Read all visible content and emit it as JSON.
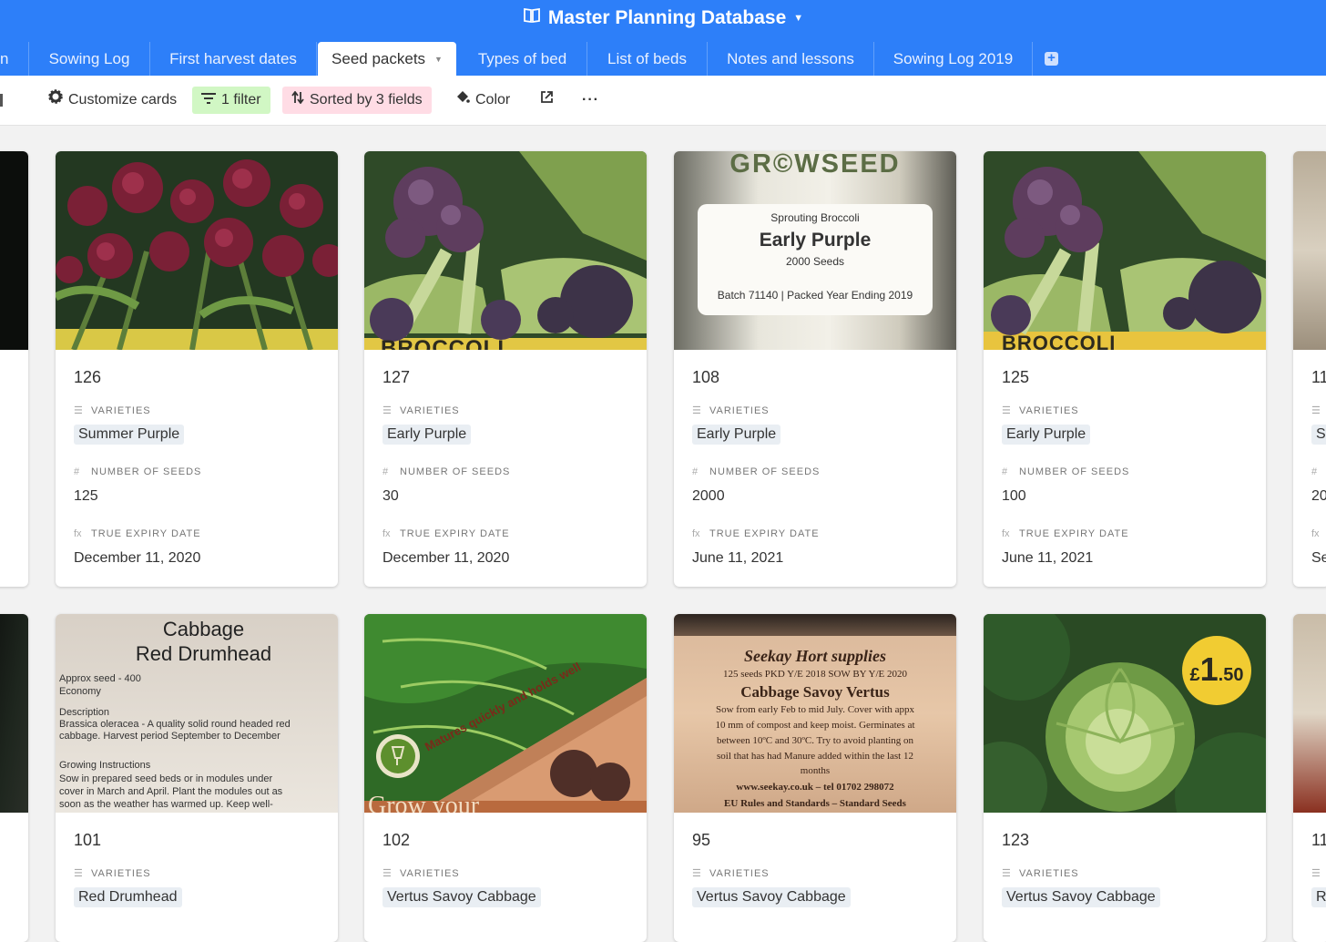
{
  "app": {
    "title": "Master Planning Database"
  },
  "tabs": [
    {
      "label": "n"
    },
    {
      "label": "Sowing Log"
    },
    {
      "label": "First harvest dates"
    },
    {
      "label": "Seed packets"
    },
    {
      "label": "Types of bed"
    },
    {
      "label": "List of beds"
    },
    {
      "label": "Notes and lessons"
    },
    {
      "label": "Sowing Log 2019"
    }
  ],
  "toolbar": {
    "customize": "Customize cards",
    "filter": "1 filter",
    "sort": "Sorted by 3 fields",
    "color": "Color"
  },
  "fields": {
    "varieties": "VARIETIES",
    "seeds": "NUMBER OF SEEDS",
    "expiry": "TRUE EXPIRY DATE"
  },
  "cards_row1": [
    {
      "id": "126",
      "variety": "Summer Purple",
      "seeds": "125",
      "expiry": "December 11, 2020"
    },
    {
      "id": "127",
      "variety": "Early Purple",
      "seeds": "30",
      "expiry": "December 11, 2020"
    },
    {
      "id": "108",
      "variety": "Early Purple",
      "seeds": "2000",
      "expiry": "June 11, 2021"
    },
    {
      "id": "125",
      "variety": "Early Purple",
      "seeds": "100",
      "expiry": "June 11, 2021"
    }
  ],
  "cards_row2": [
    {
      "id": "101",
      "variety": "Red Drumhead"
    },
    {
      "id": "102",
      "variety": "Vertus Savoy Cabbage"
    },
    {
      "id": "95",
      "variety": "Vertus Savoy Cabbage"
    },
    {
      "id": "123",
      "variety": "Vertus Savoy Cabbage"
    }
  ],
  "partial": {
    "r1_id": "11",
    "r1_chip": "Sa",
    "r1_seeds": "20",
    "r1_expiry": "Se",
    "r2_id": "11",
    "r2_chip": "Re"
  },
  "packets": {
    "growseed_brand": "GR©WSEED",
    "growseed_type": "Sprouting Broccoli",
    "growseed_name": "Early Purple",
    "growseed_count": "2000 Seeds",
    "growseed_batch": "Batch 71140 | Packed Year Ending 2019",
    "broccoli_band": "BROCCOLI",
    "broccoli_band_cut": "BROCCOLI",
    "cab_title1": "Cabbage",
    "cab_title2": "Red Drumhead",
    "cab_l1": "Approx seed - 400",
    "cab_l2": "Economy",
    "cab_l3": "Description",
    "cab_l4": "Brassica oleracea - A quality solid round headed red",
    "cab_l5": "cabbage. Harvest period September to December",
    "cab_l6": "Growing Instructions",
    "cab_l7": "Sow in prepared seed beds or in modules under",
    "cab_l8": "cover in March and April. Plant the modules out as",
    "cab_l9": "soon as the weather has warmed up. Keep well-",
    "savoy_banner": "Matures quickly and holds well",
    "savoy_brand": "Grow your",
    "seekay_title": "Seekay Hort supplies",
    "seekay_l1": "125 seeds PKD Y/E 2018 SOW BY Y/E 2020",
    "seekay_name": "Cabbage Savoy Vertus",
    "seekay_l2": "Sow from early Feb to mid July. Cover with appx",
    "seekay_l3": "10 mm of compost and keep moist. Germinates at",
    "seekay_l4": "between 10ºC and 30ºC. Try to avoid planting on",
    "seekay_l5": "soil that has had Manure added within the last 12",
    "seekay_l6": "months",
    "seekay_l7": "www.seekay.co.uk – tel 01702 298072",
    "seekay_l8": "EU Rules and Standards – Standard Seeds",
    "price_cur": "£",
    "price_main": "1",
    "price_dec": ".50"
  }
}
